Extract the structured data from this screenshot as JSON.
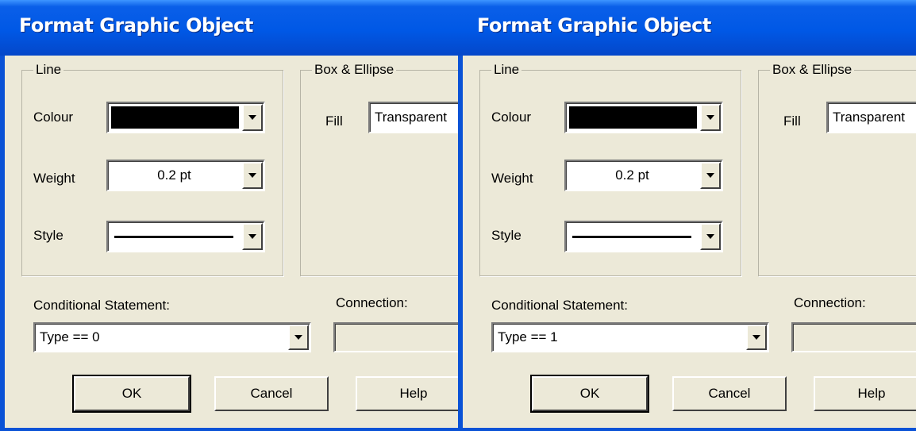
{
  "dialogs": [
    {
      "title": "Format Graphic Object",
      "line_group": {
        "label": "Line",
        "colour_label": "Colour",
        "colour_value": "#000000",
        "weight_label": "Weight",
        "weight_value": "0.2 pt",
        "style_label": "Style",
        "style_value": "solid-line"
      },
      "box_group": {
        "label": "Box & Ellipse",
        "fill_label": "Fill",
        "fill_value": "Transparent"
      },
      "conditional": {
        "label": "Conditional Statement:",
        "value": "Type == 0"
      },
      "connection": {
        "label": "Connection:",
        "value": ""
      },
      "buttons": {
        "ok": "OK",
        "cancel": "Cancel",
        "help": "Help"
      }
    },
    {
      "title": "Format Graphic Object",
      "line_group": {
        "label": "Line",
        "colour_label": "Colour",
        "colour_value": "#000000",
        "weight_label": "Weight",
        "weight_value": "0.2 pt",
        "style_label": "Style",
        "style_value": "solid-line"
      },
      "box_group": {
        "label": "Box & Ellipse",
        "fill_label": "Fill",
        "fill_value": "Transparent"
      },
      "conditional": {
        "label": "Conditional Statement:",
        "value": "Type == 1"
      },
      "connection": {
        "label": "Connection:",
        "value": ""
      },
      "buttons": {
        "ok": "OK",
        "cancel": "Cancel",
        "help": "Help"
      }
    }
  ],
  "colors": {
    "titlebar": "#0058e6",
    "dialog_face": "#ece9d8",
    "title_text": "#ffffff"
  }
}
